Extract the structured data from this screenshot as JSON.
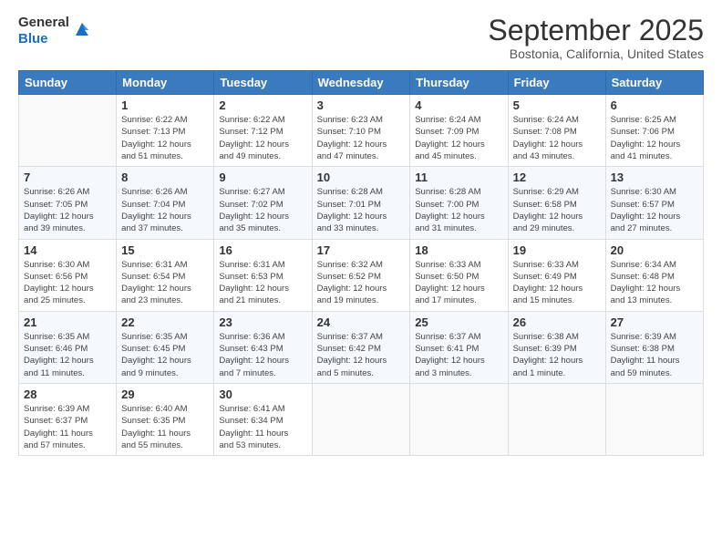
{
  "logo": {
    "general": "General",
    "blue": "Blue"
  },
  "title": "September 2025",
  "subtitle": "Bostonia, California, United States",
  "days_of_week": [
    "Sunday",
    "Monday",
    "Tuesday",
    "Wednesday",
    "Thursday",
    "Friday",
    "Saturday"
  ],
  "weeks": [
    [
      {
        "day": "",
        "info": ""
      },
      {
        "day": "1",
        "info": "Sunrise: 6:22 AM\nSunset: 7:13 PM\nDaylight: 12 hours\nand 51 minutes."
      },
      {
        "day": "2",
        "info": "Sunrise: 6:22 AM\nSunset: 7:12 PM\nDaylight: 12 hours\nand 49 minutes."
      },
      {
        "day": "3",
        "info": "Sunrise: 6:23 AM\nSunset: 7:10 PM\nDaylight: 12 hours\nand 47 minutes."
      },
      {
        "day": "4",
        "info": "Sunrise: 6:24 AM\nSunset: 7:09 PM\nDaylight: 12 hours\nand 45 minutes."
      },
      {
        "day": "5",
        "info": "Sunrise: 6:24 AM\nSunset: 7:08 PM\nDaylight: 12 hours\nand 43 minutes."
      },
      {
        "day": "6",
        "info": "Sunrise: 6:25 AM\nSunset: 7:06 PM\nDaylight: 12 hours\nand 41 minutes."
      }
    ],
    [
      {
        "day": "7",
        "info": "Sunrise: 6:26 AM\nSunset: 7:05 PM\nDaylight: 12 hours\nand 39 minutes."
      },
      {
        "day": "8",
        "info": "Sunrise: 6:26 AM\nSunset: 7:04 PM\nDaylight: 12 hours\nand 37 minutes."
      },
      {
        "day": "9",
        "info": "Sunrise: 6:27 AM\nSunset: 7:02 PM\nDaylight: 12 hours\nand 35 minutes."
      },
      {
        "day": "10",
        "info": "Sunrise: 6:28 AM\nSunset: 7:01 PM\nDaylight: 12 hours\nand 33 minutes."
      },
      {
        "day": "11",
        "info": "Sunrise: 6:28 AM\nSunset: 7:00 PM\nDaylight: 12 hours\nand 31 minutes."
      },
      {
        "day": "12",
        "info": "Sunrise: 6:29 AM\nSunset: 6:58 PM\nDaylight: 12 hours\nand 29 minutes."
      },
      {
        "day": "13",
        "info": "Sunrise: 6:30 AM\nSunset: 6:57 PM\nDaylight: 12 hours\nand 27 minutes."
      }
    ],
    [
      {
        "day": "14",
        "info": "Sunrise: 6:30 AM\nSunset: 6:56 PM\nDaylight: 12 hours\nand 25 minutes."
      },
      {
        "day": "15",
        "info": "Sunrise: 6:31 AM\nSunset: 6:54 PM\nDaylight: 12 hours\nand 23 minutes."
      },
      {
        "day": "16",
        "info": "Sunrise: 6:31 AM\nSunset: 6:53 PM\nDaylight: 12 hours\nand 21 minutes."
      },
      {
        "day": "17",
        "info": "Sunrise: 6:32 AM\nSunset: 6:52 PM\nDaylight: 12 hours\nand 19 minutes."
      },
      {
        "day": "18",
        "info": "Sunrise: 6:33 AM\nSunset: 6:50 PM\nDaylight: 12 hours\nand 17 minutes."
      },
      {
        "day": "19",
        "info": "Sunrise: 6:33 AM\nSunset: 6:49 PM\nDaylight: 12 hours\nand 15 minutes."
      },
      {
        "day": "20",
        "info": "Sunrise: 6:34 AM\nSunset: 6:48 PM\nDaylight: 12 hours\nand 13 minutes."
      }
    ],
    [
      {
        "day": "21",
        "info": "Sunrise: 6:35 AM\nSunset: 6:46 PM\nDaylight: 12 hours\nand 11 minutes."
      },
      {
        "day": "22",
        "info": "Sunrise: 6:35 AM\nSunset: 6:45 PM\nDaylight: 12 hours\nand 9 minutes."
      },
      {
        "day": "23",
        "info": "Sunrise: 6:36 AM\nSunset: 6:43 PM\nDaylight: 12 hours\nand 7 minutes."
      },
      {
        "day": "24",
        "info": "Sunrise: 6:37 AM\nSunset: 6:42 PM\nDaylight: 12 hours\nand 5 minutes."
      },
      {
        "day": "25",
        "info": "Sunrise: 6:37 AM\nSunset: 6:41 PM\nDaylight: 12 hours\nand 3 minutes."
      },
      {
        "day": "26",
        "info": "Sunrise: 6:38 AM\nSunset: 6:39 PM\nDaylight: 12 hours\nand 1 minute."
      },
      {
        "day": "27",
        "info": "Sunrise: 6:39 AM\nSunset: 6:38 PM\nDaylight: 11 hours\nand 59 minutes."
      }
    ],
    [
      {
        "day": "28",
        "info": "Sunrise: 6:39 AM\nSunset: 6:37 PM\nDaylight: 11 hours\nand 57 minutes."
      },
      {
        "day": "29",
        "info": "Sunrise: 6:40 AM\nSunset: 6:35 PM\nDaylight: 11 hours\nand 55 minutes."
      },
      {
        "day": "30",
        "info": "Sunrise: 6:41 AM\nSunset: 6:34 PM\nDaylight: 11 hours\nand 53 minutes."
      },
      {
        "day": "",
        "info": ""
      },
      {
        "day": "",
        "info": ""
      },
      {
        "day": "",
        "info": ""
      },
      {
        "day": "",
        "info": ""
      }
    ]
  ]
}
